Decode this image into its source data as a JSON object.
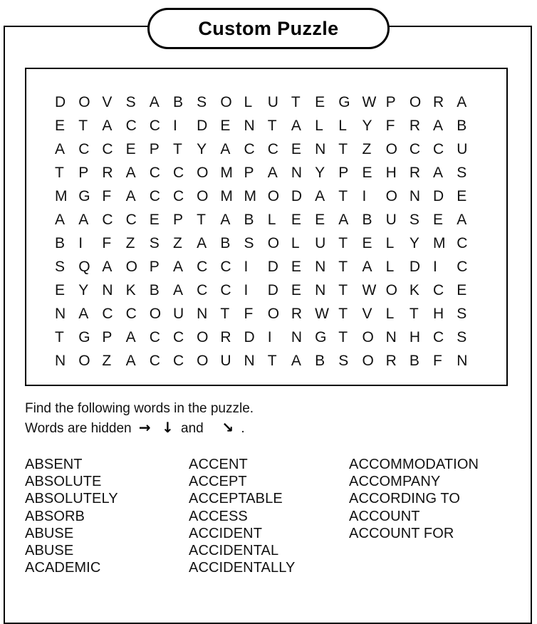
{
  "page": {
    "title": "Custom Puzzle"
  },
  "grid": {
    "rows": 12,
    "cols": 18,
    "letters": [
      [
        "D",
        "O",
        "V",
        "S",
        "A",
        "B",
        "S",
        "O",
        "L",
        "U",
        "T",
        "E",
        "G",
        "W",
        "P",
        "O",
        "R",
        "A"
      ],
      [
        "E",
        "T",
        "A",
        "C",
        "C",
        "I",
        "D",
        "E",
        "N",
        "T",
        "A",
        "L",
        "L",
        "Y",
        "F",
        "R",
        "A",
        "B"
      ],
      [
        "A",
        "C",
        "C",
        "E",
        "P",
        "T",
        "Y",
        "A",
        "C",
        "C",
        "E",
        "N",
        "T",
        "Z",
        "O",
        "C",
        "C",
        "U"
      ],
      [
        "T",
        "P",
        "R",
        "A",
        "C",
        "C",
        "O",
        "M",
        "P",
        "A",
        "N",
        "Y",
        "P",
        "E",
        "H",
        "R",
        "A",
        "S"
      ],
      [
        "M",
        "G",
        "F",
        "A",
        "C",
        "C",
        "O",
        "M",
        "M",
        "O",
        "D",
        "A",
        "T",
        "I",
        "O",
        "N",
        "D",
        "E"
      ],
      [
        "A",
        "A",
        "C",
        "C",
        "E",
        "P",
        "T",
        "A",
        "B",
        "L",
        "E",
        "E",
        "A",
        "B",
        "U",
        "S",
        "E",
        "A"
      ],
      [
        "B",
        "I",
        "F",
        "Z",
        "S",
        "Z",
        "A",
        "B",
        "S",
        "O",
        "L",
        "U",
        "T",
        "E",
        "L",
        "Y",
        "M",
        "C"
      ],
      [
        "S",
        "Q",
        "A",
        "O",
        "P",
        "A",
        "C",
        "C",
        "I",
        "D",
        "E",
        "N",
        "T",
        "A",
        "L",
        "D",
        "I",
        "C"
      ],
      [
        "E",
        "Y",
        "N",
        "K",
        "B",
        "A",
        "C",
        "C",
        "I",
        "D",
        "E",
        "N",
        "T",
        "W",
        "O",
        "K",
        "C",
        "E"
      ],
      [
        "N",
        "A",
        "C",
        "C",
        "O",
        "U",
        "N",
        "T",
        "F",
        "O",
        "R",
        "W",
        "T",
        "V",
        "L",
        "T",
        "H",
        "S"
      ],
      [
        "T",
        "G",
        "P",
        "A",
        "C",
        "C",
        "O",
        "R",
        "D",
        "I",
        "N",
        "G",
        "T",
        "O",
        "N",
        "H",
        "C",
        "S"
      ],
      [
        "N",
        "O",
        "Z",
        "A",
        "C",
        "C",
        "O",
        "U",
        "N",
        "T",
        "A",
        "B",
        "S",
        "O",
        "R",
        "B",
        "F",
        "N"
      ]
    ]
  },
  "instructions": {
    "line1": "Find the following words in the puzzle.",
    "line2_prefix": "Words are hidden",
    "arrow_right": "→",
    "arrow_down": "↓",
    "line2_conjunction": "and",
    "arrow_diagonal": "↘",
    "line2_suffix": "."
  },
  "word_list": {
    "column1": [
      "ABSENT",
      "ABSOLUTE",
      "ABSOLUTELY",
      "ABSORB",
      "ABUSE",
      "ABUSE",
      "ACADEMIC"
    ],
    "column2": [
      "ACCENT",
      "ACCEPT",
      "ACCEPTABLE",
      "ACCESS",
      "ACCIDENT",
      "ACCIDENTAL",
      "ACCIDENTALLY"
    ],
    "column3": [
      "ACCOMMODATION",
      "ACCOMPANY",
      "ACCORDING TO",
      "ACCOUNT",
      "ACCOUNT FOR"
    ]
  },
  "colors": {
    "border": "#000000",
    "text": "#111111",
    "background": "#ffffff"
  }
}
